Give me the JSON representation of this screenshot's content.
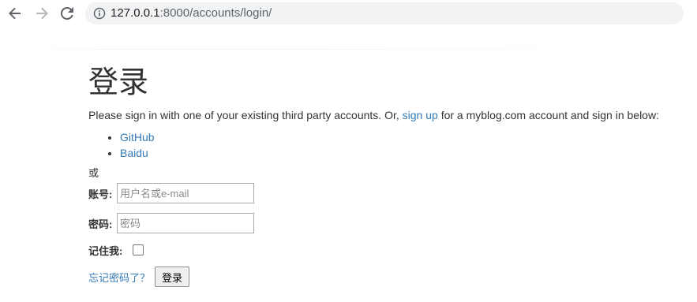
{
  "browser": {
    "url_host": "127.0.0.1",
    "url_path": ":8000/accounts/login/"
  },
  "page": {
    "title": "登录",
    "intro_before": "Please sign in with one of your existing third party accounts. Or, ",
    "signup_link": "sign up",
    "intro_after": " for a myblog.com account and sign in below:",
    "providers": [
      "GitHub",
      "Baidu"
    ],
    "or_text": "或"
  },
  "form": {
    "username_label": "账号:",
    "username_placeholder": "用户名或e-mail",
    "password_label": "密码:",
    "password_placeholder": "密码",
    "remember_label": "记住我:",
    "forgot_link": "忘记密码了？",
    "submit_label": "登录"
  },
  "colors": {
    "link": "#337ab7",
    "text": "#333333",
    "omnibox": "#f1f3f4"
  }
}
